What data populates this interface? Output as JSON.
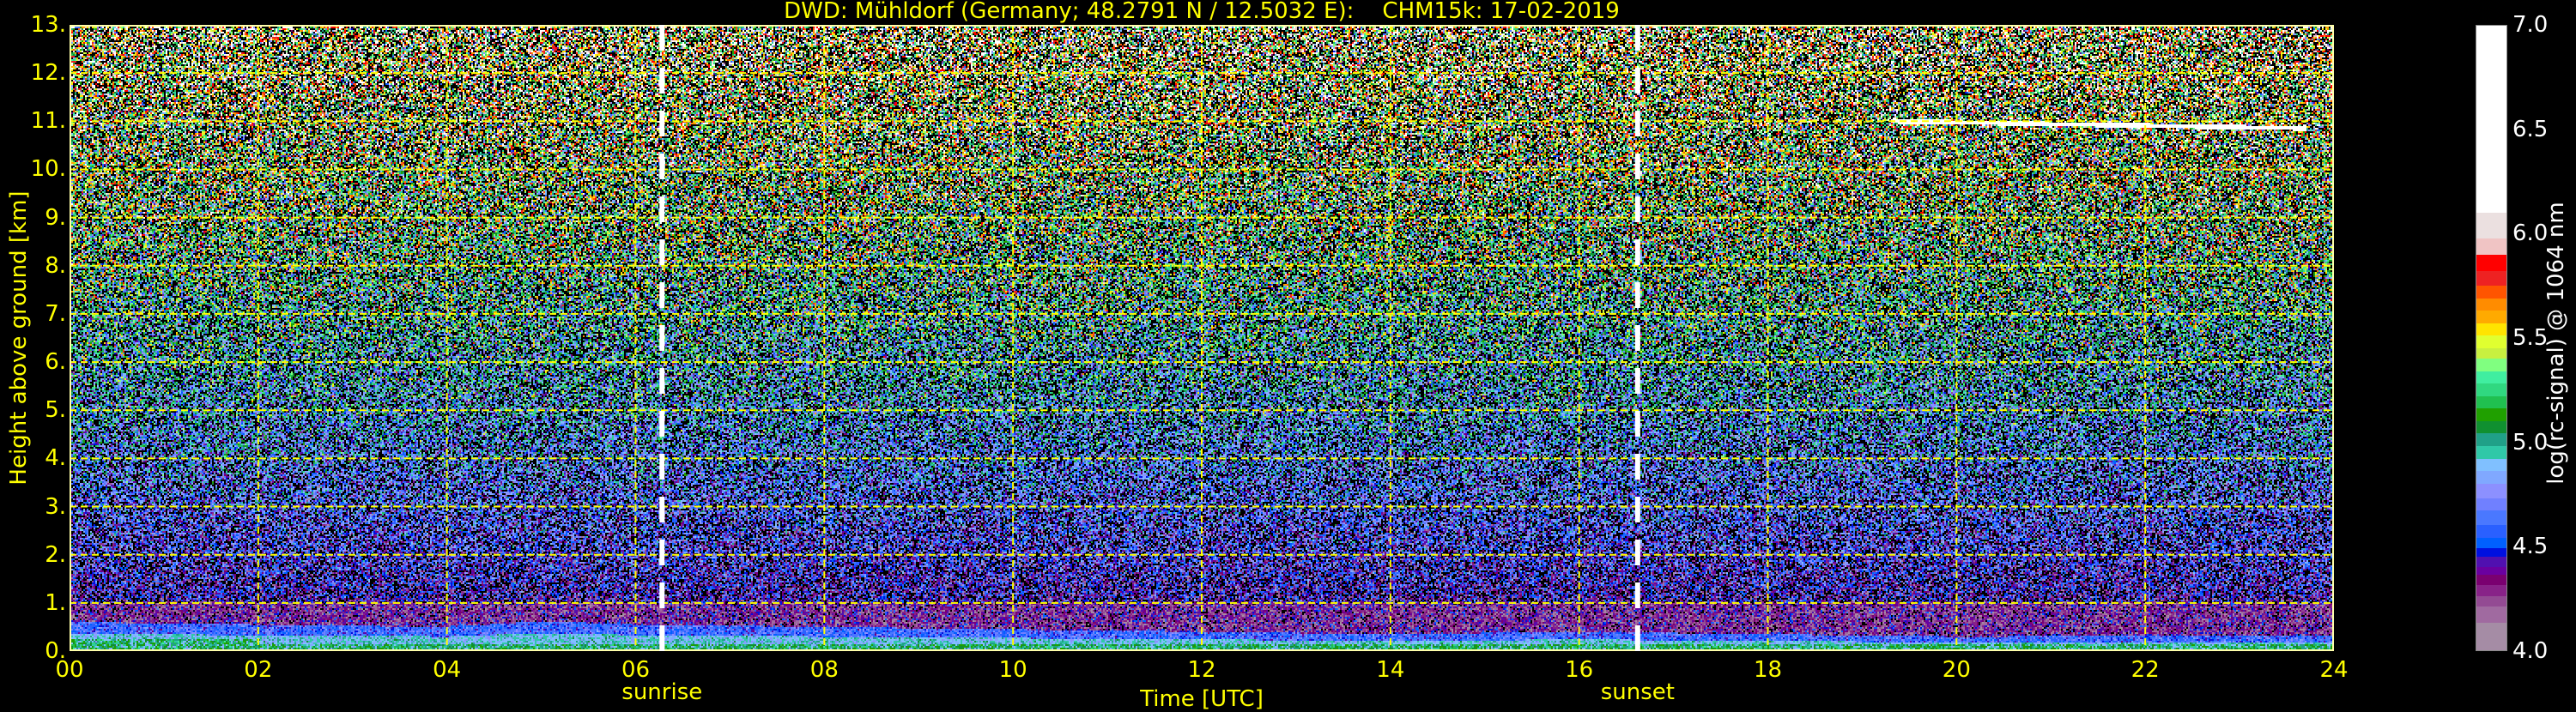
{
  "chart_data": {
    "type": "heatmap",
    "title": "DWD: Mühldorf (Germany; 48.2791 N / 12.5032 E):    CHM15k: 17-02-2019",
    "xlabel": "Time [UTC]",
    "ylabel": "Height above ground [km]",
    "xlim": [
      0,
      24
    ],
    "ylim": [
      0,
      13
    ],
    "grid": true,
    "grid_color": "#ffff00",
    "text_color": "#ffff00",
    "background": "#000000",
    "x_ticks": [
      0,
      2,
      4,
      6,
      8,
      10,
      12,
      14,
      16,
      18,
      20,
      22,
      24
    ],
    "x_tick_labels": [
      "00",
      "02",
      "04",
      "06",
      "08",
      "10",
      "12",
      "14",
      "16",
      "18",
      "20",
      "22",
      "24"
    ],
    "y_ticks": [
      0,
      1,
      2,
      3,
      4,
      5,
      6,
      7,
      8,
      9,
      10,
      11,
      12,
      13
    ],
    "y_tick_labels": [
      "0.",
      "1.",
      "2.",
      "3.",
      "4.",
      "5.",
      "6.",
      "7.",
      "8.",
      "9.",
      "10.",
      "11.",
      "12.",
      "13."
    ],
    "annotations": [
      {
        "label": "sunrise",
        "time_h": 6.28
      },
      {
        "label": "sunset",
        "time_h": 16.62
      }
    ],
    "cloud_layer": {
      "start_h": 19.3,
      "end_h": 23.7,
      "height_km": [
        11.0,
        10.85
      ]
    },
    "colorbar": {
      "label": "log(rc-signal) @ 1064 nm",
      "range": [
        4.0,
        7.0
      ],
      "ticks": [
        4.0,
        4.5,
        5.0,
        5.5,
        6.0,
        6.5,
        7.0
      ],
      "tick_labels": [
        "4.0",
        "4.5",
        "5.0",
        "5.5",
        "6.0",
        "6.5",
        "7.0"
      ],
      "bounds": [
        4.0,
        4.13,
        4.21,
        4.26,
        4.31,
        4.36,
        4.4,
        4.45,
        4.49,
        4.54,
        4.6,
        4.67,
        4.73,
        4.8,
        4.86,
        4.92,
        4.98,
        5.04,
        5.1,
        5.16,
        5.22,
        5.28,
        5.34,
        5.4,
        5.45,
        5.51,
        5.57,
        5.63,
        5.69,
        5.75,
        5.82,
        5.9,
        5.98,
        6.1,
        7.0
      ],
      "colors": [
        "#a58ca5",
        "#a06aa0",
        "#934a93",
        "#882288",
        "#7a0070",
        "#6a00a0",
        "#5010b0",
        "#0010e0",
        "#0060ff",
        "#2a60ff",
        "#4a78ff",
        "#7080ff",
        "#8c90ff",
        "#80a8ff",
        "#80c0ff",
        "#30c8a8",
        "#20a088",
        "#109030",
        "#20a000",
        "#20c050",
        "#30d880",
        "#40eea0",
        "#80ff80",
        "#c8f040",
        "#e0ff30",
        "#ffe400",
        "#ffaa00",
        "#ff8c00",
        "#ff5500",
        "#ee2222",
        "#ff0000",
        "#f0c4c4",
        "#ebe0e0",
        "#ffffff"
      ]
    }
  }
}
